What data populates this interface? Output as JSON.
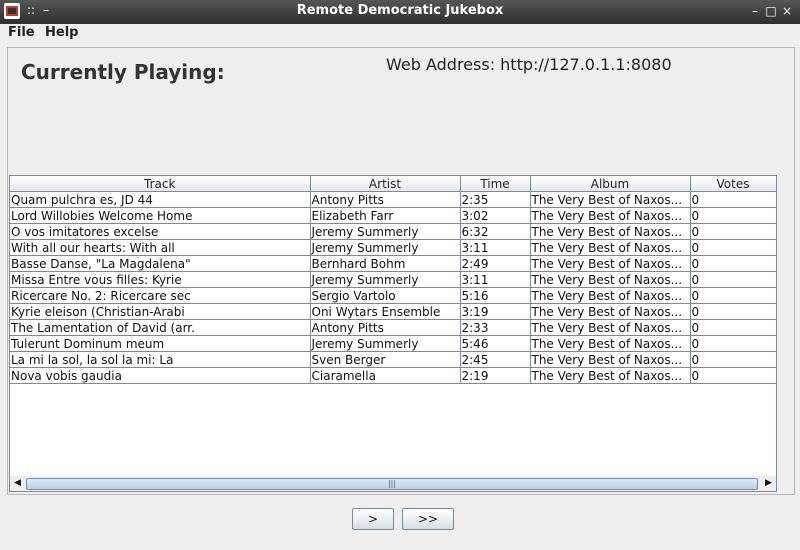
{
  "window": {
    "title": "Remote Democratic Jukebox",
    "titlebar_glyphs": [
      "::",
      "–"
    ],
    "controls": [
      "–",
      "□",
      "×"
    ]
  },
  "menu": [
    "File",
    "Help"
  ],
  "now_playing_label": "Currently Playing:",
  "web_address": "Web Address: http://127.0.1.1:8080",
  "table": {
    "columns": [
      "Track",
      "Artist",
      "Time",
      "Album",
      "Votes"
    ],
    "rows": [
      [
        "Quam pulchra es, JD 44",
        "Antony Pitts",
        "2:35",
        "The Very Best of Naxos...",
        "0"
      ],
      [
        "Lord Willobies Welcome Home",
        "Elizabeth Farr",
        "3:02",
        "The Very Best of Naxos...",
        "0"
      ],
      [
        "O vos imitatores excelse",
        "Jeremy Summerly",
        "6:32",
        "The Very Best of Naxos...",
        "0"
      ],
      [
        "With all our hearts: With all",
        "Jeremy Summerly",
        "3:11",
        "The Very Best of Naxos...",
        "0"
      ],
      [
        "Basse Danse, \"La Magdalena\"",
        "Bernhard Bohm",
        "2:49",
        "The Very Best of Naxos...",
        "0"
      ],
      [
        "Missa Entre vous filles: Kyrie",
        "Jeremy Summerly",
        "3:11",
        "The Very Best of Naxos...",
        "0"
      ],
      [
        "Ricercare No. 2: Ricercare sec",
        "Sergio Vartolo",
        "5:16",
        "The Very Best of Naxos...",
        "0"
      ],
      [
        "Kyrie eleison (Christian-Arabi",
        "Oni Wytars Ensemble",
        "3:19",
        "The Very Best of Naxos...",
        "0"
      ],
      [
        "The Lamentation of David (arr.",
        "Antony Pitts",
        "2:33",
        "The Very Best of Naxos...",
        "0"
      ],
      [
        "Tulerunt Dominum meum",
        "Jeremy Summerly",
        "5:46",
        "The Very Best of Naxos...",
        "0"
      ],
      [
        "La mi la sol, la sol la mi: La",
        "Sven Berger",
        "2:45",
        "The Very Best of Naxos...",
        "0"
      ],
      [
        "Nova vobis gaudia",
        "Ciaramella",
        "2:19",
        "The Very Best of Naxos...",
        "0"
      ]
    ]
  },
  "scrollbar": {
    "left_arrow": "◀",
    "right_arrow": "▶",
    "grip": "|||"
  },
  "buttons": {
    "play": ">",
    "skip": ">>"
  },
  "icons": [
    "jukebox-app-icon",
    "minimize-icon",
    "maximize-icon",
    "close-icon"
  ]
}
